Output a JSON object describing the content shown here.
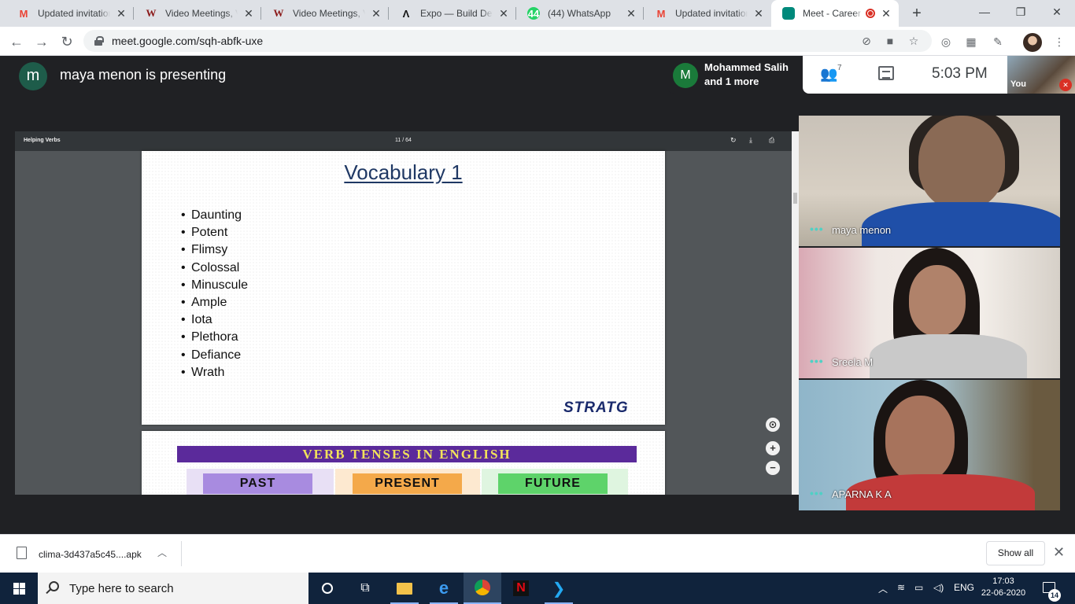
{
  "tabs": [
    {
      "icon": "gmail-icon",
      "title": "Updated invitation"
    },
    {
      "icon": "w-icon",
      "title": "Video Meetings, Video"
    },
    {
      "icon": "w-icon",
      "title": "Video Meetings, Video"
    },
    {
      "icon": "expo-icon",
      "title": "Expo — Build Details"
    },
    {
      "icon": "whatsapp-icon",
      "title": "(44) WhatsApp",
      "badge": "44"
    },
    {
      "icon": "gmail-icon",
      "title": "Updated invitation"
    },
    {
      "icon": "meet-icon",
      "title": "Meet - Career",
      "active": true,
      "recording": true
    }
  ],
  "address_bar": {
    "url": "meet.google.com/sqh-abfk-uxe"
  },
  "meet": {
    "presenter_initial": "m",
    "presenter_text": "maya menon is presenting",
    "joined_initial": "M",
    "joined_line1": "Mohammed Salih",
    "joined_line2": "and 1 more",
    "people_count": "7",
    "time": "5:03  PM",
    "self_label": "You"
  },
  "pdf": {
    "title": "Helping Verbs",
    "page": "11 / 64",
    "slide1": {
      "title": "Vocabulary 1",
      "words": [
        "Daunting",
        "Potent",
        "Flimsy",
        "Colossal",
        "Minuscule",
        "Ample",
        "Iota",
        "Plethora",
        "Defiance",
        "Wrath"
      ],
      "logo": "STRATG"
    },
    "slide2": {
      "banner": "VERB TENSES IN ENGLISH",
      "tenses": [
        "PAST",
        "PRESENT",
        "FUTURE"
      ]
    }
  },
  "participants": [
    {
      "name": "maya menon"
    },
    {
      "name": "Sreela M"
    },
    {
      "name": "APARNA K A"
    }
  ],
  "download": {
    "file": "clima-3d437a5c45....apk",
    "show_all": "Show all"
  },
  "taskbar": {
    "search_placeholder": "Type here to search",
    "language": "ENG",
    "time": "17:03",
    "date": "22-06-2020",
    "notifications": "14"
  },
  "colors": {
    "accent": "#1a73e8",
    "meet_green": "#00897b",
    "recording": "#d93025",
    "taskbar": "#10233c"
  }
}
